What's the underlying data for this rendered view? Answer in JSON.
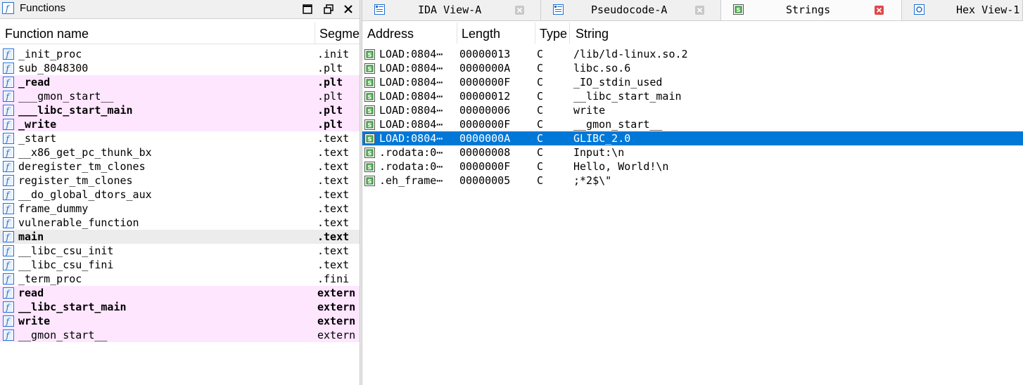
{
  "functions_panel": {
    "title": "Functions",
    "col_name": "Function name",
    "col_segment": "Segme",
    "rows": [
      {
        "name": "_init_proc",
        "segment": ".init",
        "style": "normal"
      },
      {
        "name": "sub_8048300",
        "segment": ".plt",
        "style": "normal"
      },
      {
        "name": "_read",
        "segment": ".plt",
        "style": "pink-bold"
      },
      {
        "name": "___gmon_start__",
        "segment": ".plt",
        "style": "pink"
      },
      {
        "name": "___libc_start_main",
        "segment": ".plt",
        "style": "pink-bold"
      },
      {
        "name": "_write",
        "segment": ".plt",
        "style": "pink-bold"
      },
      {
        "name": "_start",
        "segment": ".text",
        "style": "normal"
      },
      {
        "name": "__x86_get_pc_thunk_bx",
        "segment": ".text",
        "style": "normal"
      },
      {
        "name": "deregister_tm_clones",
        "segment": ".text",
        "style": "normal"
      },
      {
        "name": "register_tm_clones",
        "segment": ".text",
        "style": "normal"
      },
      {
        "name": "__do_global_dtors_aux",
        "segment": ".text",
        "style": "normal"
      },
      {
        "name": "frame_dummy",
        "segment": ".text",
        "style": "normal"
      },
      {
        "name": "vulnerable_function",
        "segment": ".text",
        "style": "normal"
      },
      {
        "name": "main",
        "segment": ".text",
        "style": "selected-bold"
      },
      {
        "name": "__libc_csu_init",
        "segment": ".text",
        "style": "normal"
      },
      {
        "name": "__libc_csu_fini",
        "segment": ".text",
        "style": "normal"
      },
      {
        "name": "_term_proc",
        "segment": ".fini",
        "style": "normal"
      },
      {
        "name": "read",
        "segment": "extern",
        "style": "pink-bold"
      },
      {
        "name": "__libc_start_main",
        "segment": "extern",
        "style": "pink-bold"
      },
      {
        "name": "write",
        "segment": "extern",
        "style": "pink-bold"
      },
      {
        "name": "__gmon_start__",
        "segment": "extern",
        "style": "pink"
      }
    ]
  },
  "tabs": [
    {
      "label": "IDA View-A",
      "icon": "disassembly-view-icon",
      "active": false,
      "close": "gray"
    },
    {
      "label": "Pseudocode-A",
      "icon": "pseudocode-view-icon",
      "active": false,
      "close": "gray"
    },
    {
      "label": "Strings",
      "icon": "strings-view-icon",
      "active": true,
      "close": "red"
    },
    {
      "label": "Hex View-1",
      "icon": "hex-view-icon",
      "active": false,
      "close": "none"
    }
  ],
  "strings_panel": {
    "headers": {
      "address": "Address",
      "length": "Length",
      "type": "Type",
      "string": "String"
    },
    "rows": [
      {
        "address": "LOAD:0804⋯",
        "length": "00000013",
        "type": "C",
        "string": "/lib/ld-linux.so.2",
        "selected": false
      },
      {
        "address": "LOAD:0804⋯",
        "length": "0000000A",
        "type": "C",
        "string": "libc.so.6",
        "selected": false
      },
      {
        "address": "LOAD:0804⋯",
        "length": "0000000F",
        "type": "C",
        "string": "_IO_stdin_used",
        "selected": false
      },
      {
        "address": "LOAD:0804⋯",
        "length": "00000012",
        "type": "C",
        "string": "__libc_start_main",
        "selected": false
      },
      {
        "address": "LOAD:0804⋯",
        "length": "00000006",
        "type": "C",
        "string": "write",
        "selected": false
      },
      {
        "address": "LOAD:0804⋯",
        "length": "0000000F",
        "type": "C",
        "string": "__gmon_start__",
        "selected": false
      },
      {
        "address": "LOAD:0804⋯",
        "length": "0000000A",
        "type": "C",
        "string": "GLIBC_2.0",
        "selected": true
      },
      {
        "address": ".rodata:0⋯",
        "length": "00000008",
        "type": "C",
        "string": "Input:\\n",
        "selected": false
      },
      {
        "address": ".rodata:0⋯",
        "length": "0000000F",
        "type": "C",
        "string": "Hello, World!\\n",
        "selected": false
      },
      {
        "address": ".eh_frame⋯",
        "length": "00000005",
        "type": "C",
        "string": ";*2$\\\"",
        "selected": false
      }
    ]
  },
  "colors": {
    "pink_row": "#ffe6ff",
    "selected_row": "#0078d7",
    "function_icon": "#1f6fd1"
  }
}
